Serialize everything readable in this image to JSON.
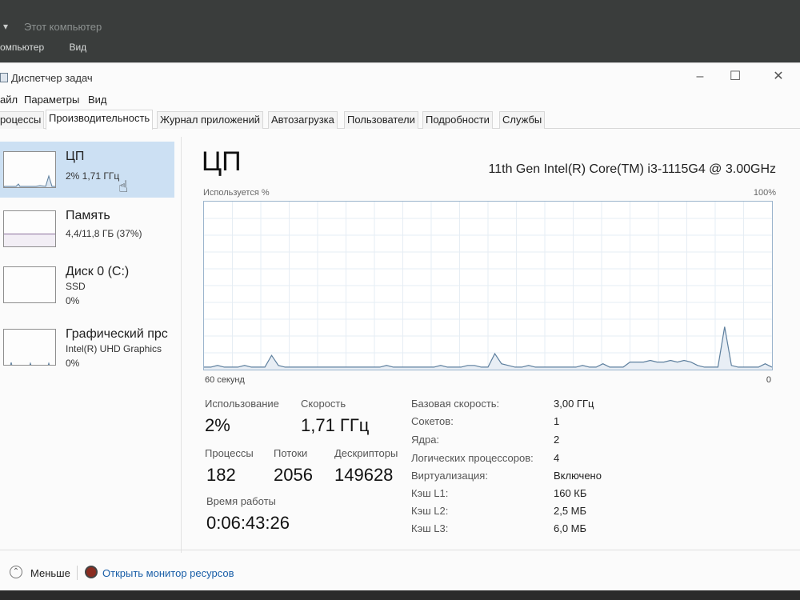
{
  "explorer": {
    "title": "Этот компьютер",
    "menu": [
      "омпьютер",
      "Вид"
    ]
  },
  "window": {
    "title": "Диспетчер задач",
    "menu": [
      "айл",
      "Параметры",
      "Вид"
    ],
    "tabs": [
      "роцессы",
      "Производительность",
      "Журнал приложений",
      "Автозагрузка",
      "Пользователи",
      "Подробности",
      "Службы"
    ],
    "active_tab": "Производительность"
  },
  "left_items": [
    {
      "name": "ЦП",
      "line1": "2%  1,71 ГГц",
      "line2": ""
    },
    {
      "name": "Память",
      "line1": "4,4/11,8 ГБ (37%)",
      "line2": ""
    },
    {
      "name": "Диск 0 (C:)",
      "line1": "SSD",
      "line2": "0%"
    },
    {
      "name": "Графический прс",
      "line1": "Intel(R) UHD Graphics",
      "line2": "0%"
    }
  ],
  "cpu": {
    "title": "ЦП",
    "model": "11th Gen Intel(R) Core(TM) i3-1115G4 @ 3.00GHz",
    "graph_label": "Используется %",
    "graph_max": "100%",
    "graph_left": "60 секунд",
    "graph_right": "0",
    "usage_label": "Использование",
    "usage_value": "2%",
    "speed_label": "Скорость",
    "speed_value": "1,71 ГГц",
    "processes_label": "Процессы",
    "processes_value": "182",
    "threads_label": "Потоки",
    "threads_value": "2056",
    "handles_label": "Дескрипторы",
    "handles_value": "149628",
    "uptime_label": "Время работы",
    "uptime_value": "0:06:43:26",
    "details": [
      {
        "label": "Базовая скорость:",
        "value": "3,00 ГГц"
      },
      {
        "label": "Сокетов:",
        "value": "1"
      },
      {
        "label": "Ядра:",
        "value": "2"
      },
      {
        "label": "Логических процессоров:",
        "value": "4"
      },
      {
        "label": "Виртуализация:",
        "value": "Включено"
      },
      {
        "label": "Кэш L1:",
        "value": "160 КБ"
      },
      {
        "label": "Кэш L2:",
        "value": "2,5 МБ"
      },
      {
        "label": "Кэш L3:",
        "value": "6,0 МБ"
      }
    ],
    "usage_history": [
      1,
      1,
      2,
      1,
      1,
      1,
      2,
      1,
      1,
      1,
      8,
      2,
      1,
      1,
      1,
      1,
      1,
      1,
      1,
      1,
      1,
      1,
      1,
      1,
      1,
      1,
      1,
      2,
      1,
      1,
      1,
      1,
      1,
      1,
      1,
      2,
      1,
      1,
      1,
      2,
      2,
      1,
      1,
      9,
      3,
      2,
      1,
      1,
      2,
      1,
      1,
      1,
      1,
      1,
      1,
      1,
      2,
      1,
      1,
      3,
      1,
      1,
      1,
      4,
      4,
      4,
      5,
      4,
      4,
      5,
      4,
      5,
      4,
      2,
      1,
      1,
      1,
      25,
      2,
      1,
      1,
      1,
      1,
      3,
      1
    ]
  },
  "footer": {
    "less": "Меньше",
    "monitor": "Открыть монитор ресурсов"
  },
  "colors": {
    "accent_selected": "#cce0f3",
    "graph_line": "#5d7f9e",
    "link": "#1a5fa8"
  }
}
